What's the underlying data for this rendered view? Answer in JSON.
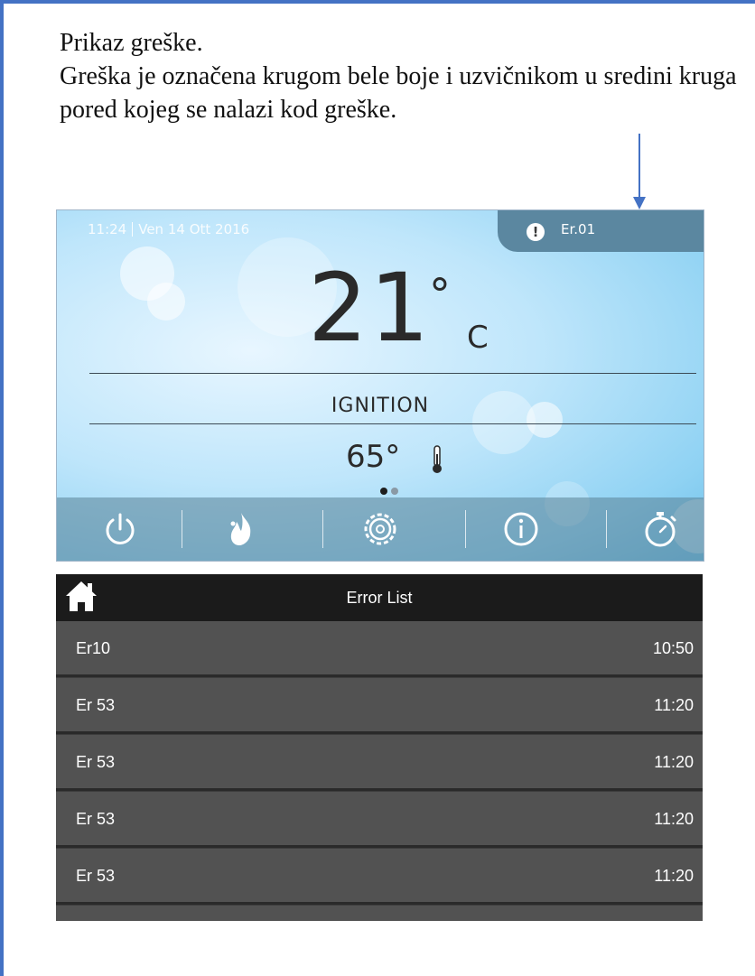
{
  "caption": {
    "line1": "Prikaz greške.",
    "line2": "Greška je označena krugom bele boje i uzvičnikom u sredini kruga pored kojeg se nalazi kod greške."
  },
  "display": {
    "time": "11:24",
    "date": "Ven 14 Ott 2016",
    "error_symbol": "!",
    "error_code": "Er.01",
    "room_temp": "21",
    "room_temp_degree": "°",
    "room_temp_unit": "C",
    "state": "IGNITION",
    "water_temp": "65°",
    "page_dots": {
      "total": 2,
      "active": 1
    },
    "toolbar_icons": [
      "power-icon",
      "flame-icon",
      "gear-icon",
      "info-icon",
      "stopwatch-icon"
    ]
  },
  "error_list": {
    "title": "Error List",
    "rows": [
      {
        "code": "Er10",
        "time": "10:50"
      },
      {
        "code": "Er 53",
        "time": "11:20"
      },
      {
        "code": "Er 53",
        "time": "11:20"
      },
      {
        "code": "Er 53",
        "time": "11:20"
      },
      {
        "code": "Er 53",
        "time": "11:20"
      }
    ]
  },
  "colors": {
    "frame": "#4472c4",
    "arrow": "#4472c4",
    "list_header": "#1b1b1b",
    "list_row": "#525252"
  }
}
